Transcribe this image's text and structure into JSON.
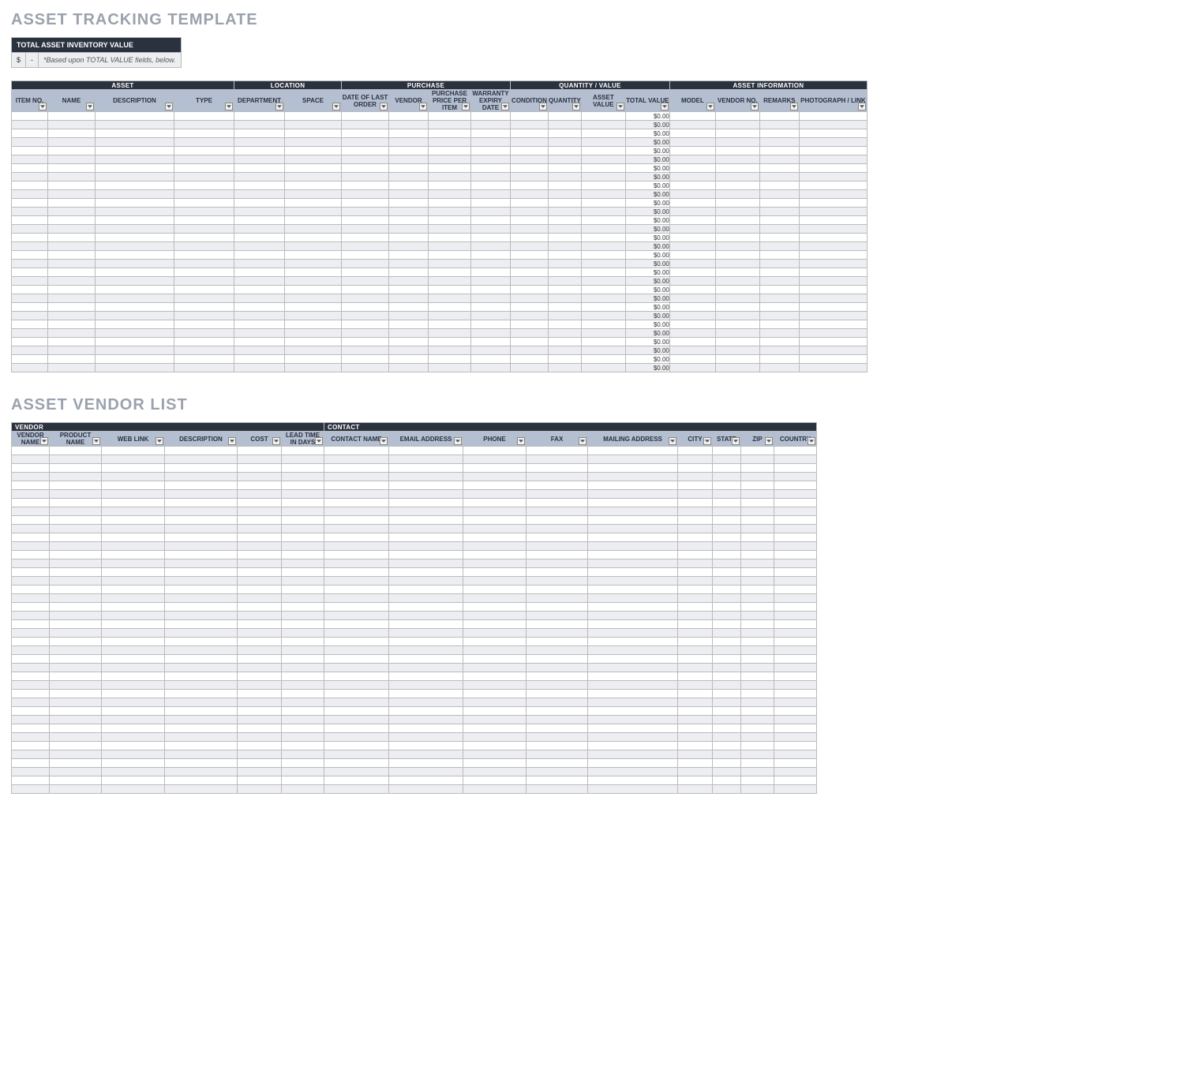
{
  "titles": {
    "asset_section": "ASSET TRACKING TEMPLATE",
    "vendor_section": "ASSET VENDOR LIST"
  },
  "total_box": {
    "header": "TOTAL ASSET INVENTORY VALUE",
    "currency": "$",
    "value": "-",
    "note": "*Based upon TOTAL VALUE fields, below."
  },
  "asset_table": {
    "groups": [
      {
        "label": "ASSET",
        "span": 4
      },
      {
        "label": "LOCATION",
        "span": 2
      },
      {
        "label": "PURCHASE",
        "span": 4
      },
      {
        "label": "QUANTITY / VALUE",
        "span": 4
      },
      {
        "label": "ASSET INFORMATION",
        "span": 4
      }
    ],
    "columns": [
      "ITEM NO.",
      "NAME",
      "DESCRIPTION",
      "TYPE",
      "DEPARTMENT",
      "SPACE",
      "DATE OF LAST ORDER",
      "VENDOR",
      "PURCHASE PRICE PER ITEM",
      "WARRANTY EXPIRY DATE",
      "CONDITION",
      "QUANTITY",
      "ASSET VALUE",
      "TOTAL VALUE",
      "MODEL",
      "VENDOR NO.",
      "REMARKS",
      "PHOTOGRAPH / LINK"
    ],
    "total_value_col_index": 13,
    "row_count": 30,
    "default_total_value": "$0.00"
  },
  "vendor_table": {
    "groups": [
      {
        "label": "VENDOR",
        "span": 6
      },
      {
        "label": "CONTACT",
        "span": 9
      }
    ],
    "columns": [
      "VENDOR NAME",
      "PRODUCT NAME",
      "WEB LINK",
      "DESCRIPTION",
      "COST",
      "LEAD TIME IN DAYS",
      "CONTACT NAME",
      "EMAIL ADDRESS",
      "PHONE",
      "FAX",
      "MAILING ADDRESS",
      "CITY",
      "STATE",
      "ZIP",
      "COUNTRY"
    ],
    "row_count": 40
  }
}
